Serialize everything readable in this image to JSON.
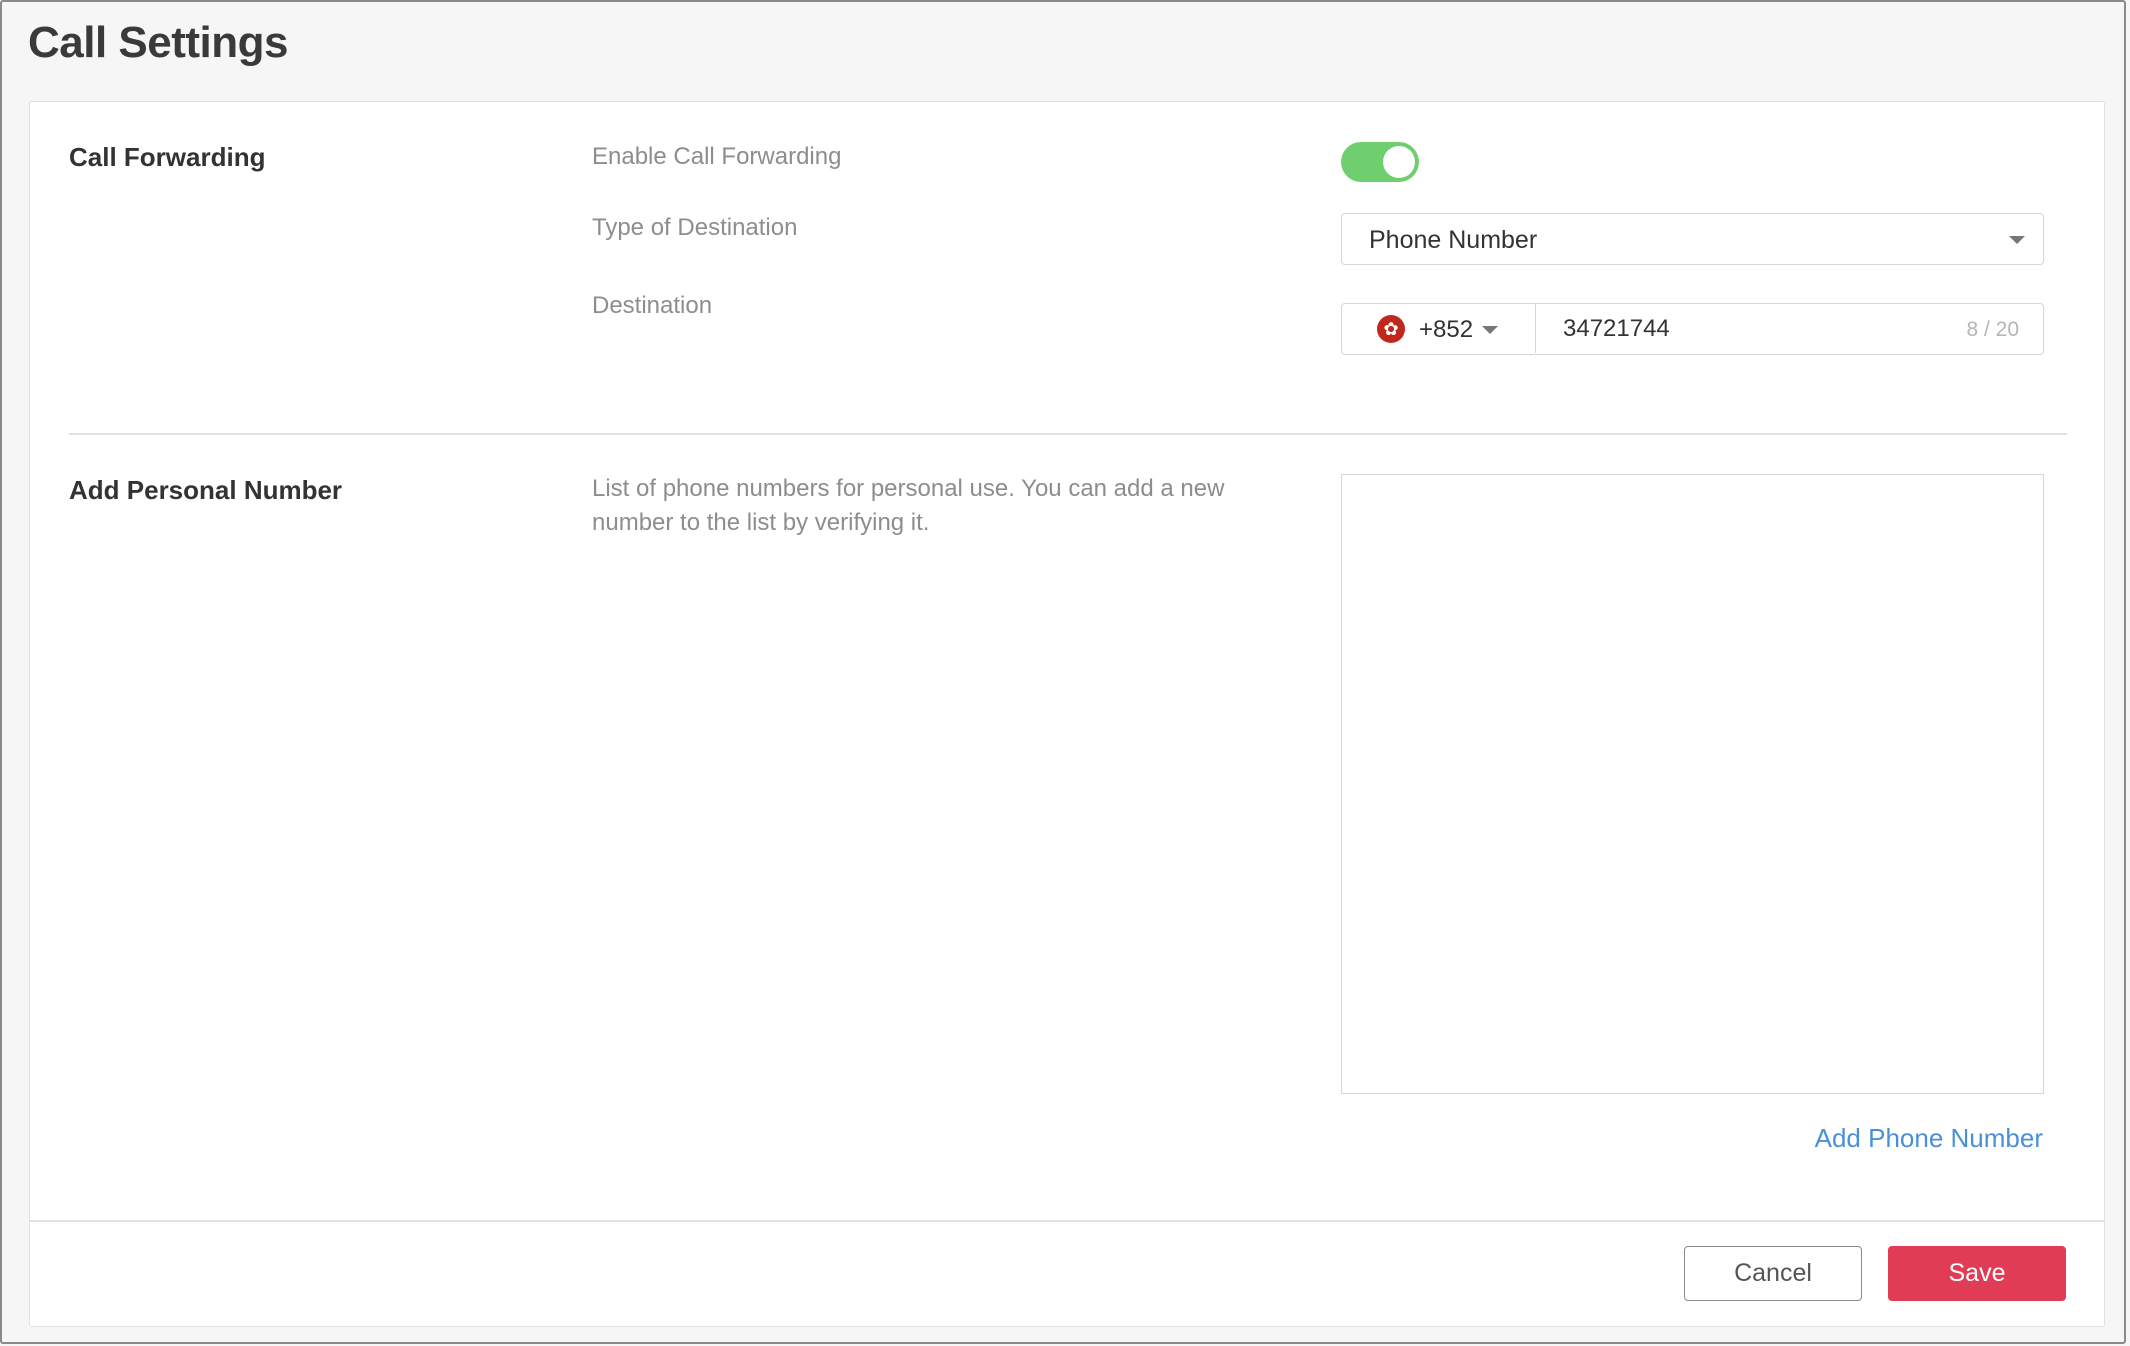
{
  "page": {
    "title": "Call Settings"
  },
  "call_forwarding": {
    "section_title": "Call Forwarding",
    "enable_label": "Enable Call Forwarding",
    "enabled": true,
    "destination_type_label": "Type of Destination",
    "destination_type_value": "Phone Number",
    "destination_label": "Destination",
    "country_code": "+852",
    "country_flag_icon": "hong-kong-flag-icon",
    "phone_value": "34721744",
    "char_counter": "8 / 20"
  },
  "personal_number": {
    "section_title": "Add Personal Number",
    "description": "List of phone numbers for personal use. You can add a new number to the list by verifying it.",
    "numbers": [],
    "add_link": "Add Phone Number"
  },
  "footer": {
    "cancel_label": "Cancel",
    "save_label": "Save"
  },
  "colors": {
    "toggle_on": "#6fcf6f",
    "save_button": "#e03c55",
    "link": "#4a90d9"
  }
}
